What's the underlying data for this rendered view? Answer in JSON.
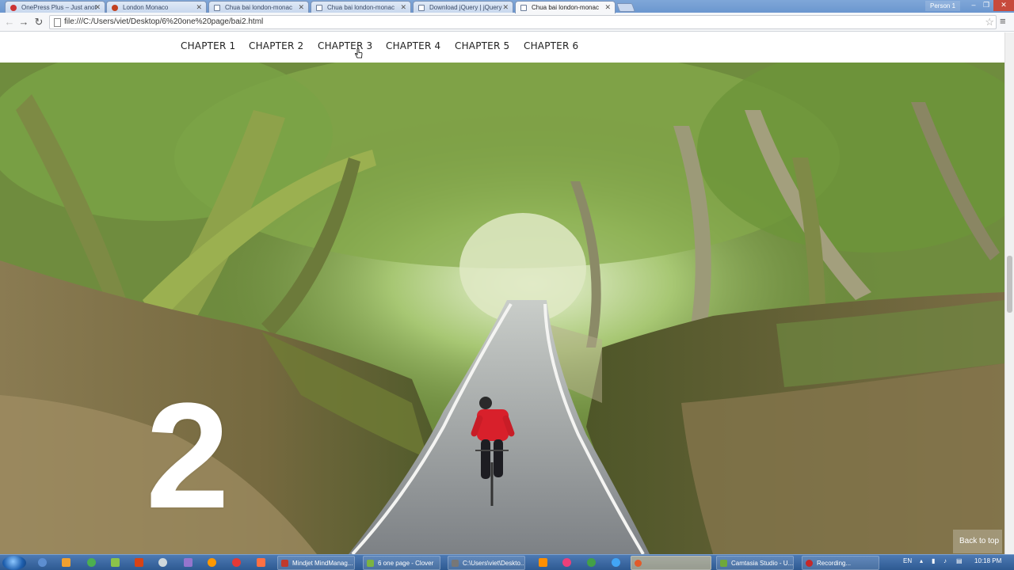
{
  "browser": {
    "tabs": [
      {
        "title": "OnePress Plus – Just anot",
        "icon": "onepress-icon"
      },
      {
        "title": "London Monaco",
        "icon": "london-monaco-icon"
      },
      {
        "title": "Chua bai london-monac",
        "icon": "page-icon"
      },
      {
        "title": "Chua bai london-monac",
        "icon": "page-icon"
      },
      {
        "title": "Download jQuery | jQuery",
        "icon": "page-icon"
      },
      {
        "title": "Chua bai london-monac",
        "icon": "page-icon",
        "active": true
      }
    ],
    "profile": "Person 1",
    "url": "file:///C:/Users/viet/Desktop/6%20one%20page/bai2.html"
  },
  "page": {
    "nav": [
      "CHAPTER 1",
      "CHAPTER 2",
      "CHAPTER 3",
      "CHAPTER 4",
      "CHAPTER 5",
      "CHAPTER 6"
    ],
    "hero_number": "2",
    "back_to_top": "Back to top"
  },
  "taskbar": {
    "tasks": [
      {
        "label": "Mindjet MindManag...",
        "color": "#c0392b"
      },
      {
        "label": "6 one page - Clover",
        "color": "#7cb342"
      },
      {
        "label": "C:\\Users\\viet\\Deskto...",
        "color": "#777777"
      },
      {
        "label": "",
        "color": "#e25b2a",
        "active": true
      },
      {
        "label": "Camtasia Studio - U...",
        "color": "#6fa83b"
      },
      {
        "label": "Recording...",
        "color": "#c62828"
      }
    ],
    "language": "EN",
    "clock": "10:18 PM"
  },
  "colors": {
    "tabstrip": "#6b96cf",
    "taskbar": "#2e5a92",
    "road": "#8a8e92",
    "foliage": "#7ea84a"
  }
}
